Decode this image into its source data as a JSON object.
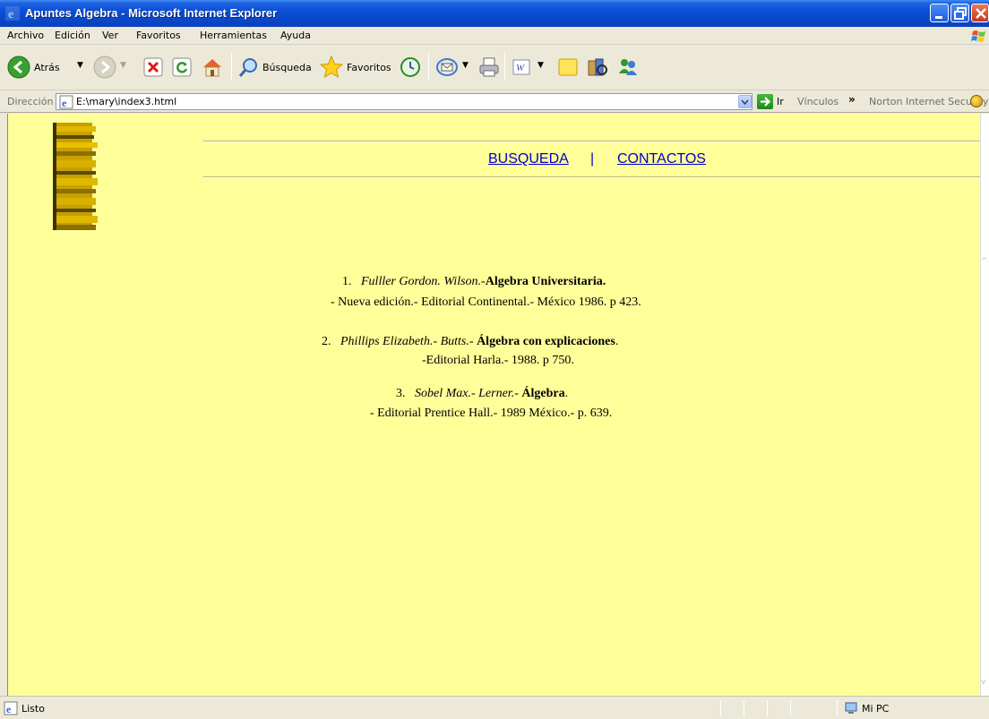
{
  "window": {
    "title": "Apuntes Algebra - Microsoft Internet Explorer"
  },
  "menu": {
    "items": [
      "Archivo",
      "Edición",
      "Ver",
      "Favoritos",
      "Herramientas",
      "Ayuda"
    ]
  },
  "toolbar": {
    "back_label": "Atrás",
    "search_label": "Búsqueda",
    "favorites_label": "Favoritos"
  },
  "address": {
    "label": "Dirección",
    "url": "E:\\mary\\index3.html",
    "go_label": "Ir",
    "links_label": "Vínculos",
    "norton_label": "Norton Internet Security"
  },
  "page": {
    "nav": {
      "search_link": "BUSQUEDA",
      "separator": "|",
      "contacts_link": "CONTACTOS"
    },
    "references": [
      {
        "number": "1.",
        "authors": "Fulller Gordon. Wilson.",
        "sep": "-",
        "title": "Algebra Universitaria.",
        "title_suffix": "",
        "details": "- Nueva edición.- Editorial Continental.- México 1986. p 423."
      },
      {
        "number": "2.",
        "authors": "Phillips Elizabeth.- Butts.",
        "sep": "- ",
        "title": "Álgebra con explicaciones",
        "title_suffix": ".",
        "details": "-Editorial Harla.- 1988. p 750."
      },
      {
        "number": "3.",
        "authors": "Sobel Max.- Lerner.",
        "sep": "- ",
        "title": "Álgebra",
        "title_suffix": ".",
        "details": "- Editorial Prentice Hall.- 1989 México.- p. 639."
      }
    ]
  },
  "status": {
    "text": "Listo",
    "zone": "Mi PC"
  },
  "colors": {
    "page_background": "#ffff99",
    "link": "#0000cc",
    "titlebar": "#0a46c8"
  }
}
